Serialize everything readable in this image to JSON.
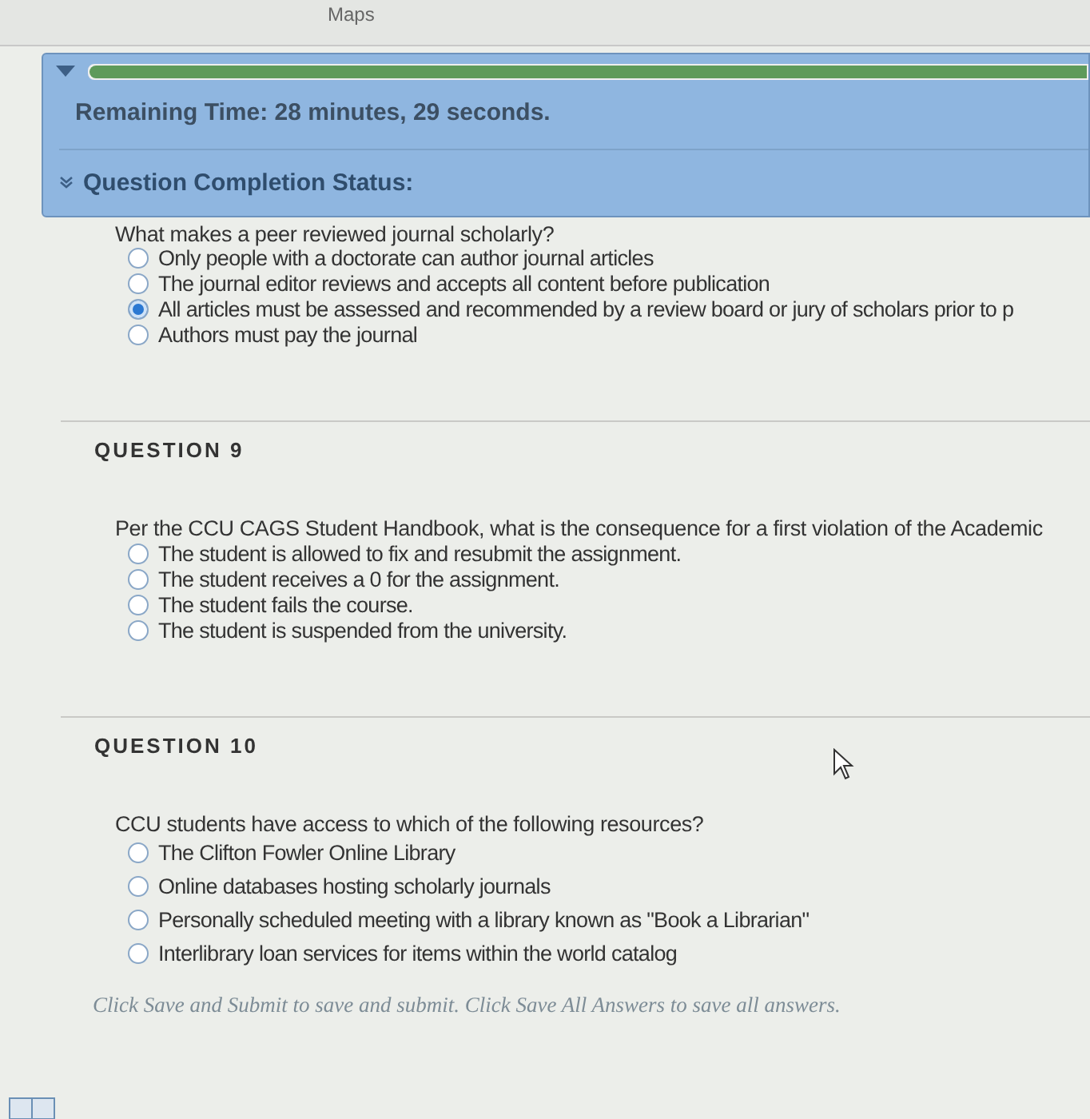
{
  "top_bar": {
    "tab_label": "Maps"
  },
  "timer_panel": {
    "expanded": true,
    "progress": {
      "level": 1
    },
    "remaining_label": "Remaining Time:",
    "remaining_value": "28 minutes, 29 seconds.",
    "completion_label": "Question Completion Status:",
    "completion_expanded": false
  },
  "questions": [
    {
      "text": "What makes a peer reviewed journal scholarly?",
      "options": [
        {
          "label": "Only people with a doctorate can author journal articles",
          "selected": false
        },
        {
          "label": "The journal editor reviews and accepts all content before publication",
          "selected": false
        },
        {
          "label": "All articles must be assessed and recommended by a review board or jury of scholars prior to p",
          "selected": true
        },
        {
          "label": "Authors must pay the journal",
          "selected": false
        }
      ]
    },
    {
      "heading": "QUESTION 9",
      "text": "Per the CCU CAGS Student Handbook, what is the consequence for a first violation of the Academic",
      "options": [
        {
          "label": "The student is allowed to fix and resubmit the assignment.",
          "selected": false
        },
        {
          "label": "The student receives a 0 for the assignment.",
          "selected": false
        },
        {
          "label": "The student fails the course.",
          "selected": false
        },
        {
          "label": "The student is suspended from the university.",
          "selected": false
        }
      ]
    },
    {
      "heading": "QUESTION 10",
      "text": "CCU students have access to which of the following resources?",
      "options": [
        {
          "label": "The Clifton Fowler Online Library",
          "selected": false
        },
        {
          "label": "Online databases hosting scholarly journals",
          "selected": false
        },
        {
          "label": "Personally scheduled meeting with a library known as \"Book a Librarian\"",
          "selected": false
        },
        {
          "label": "Interlibrary loan services for items within the world catalog",
          "selected": false
        }
      ]
    }
  ],
  "footer_note": "Click Save and Submit to save and submit. Click Save All Answers to save all answers."
}
